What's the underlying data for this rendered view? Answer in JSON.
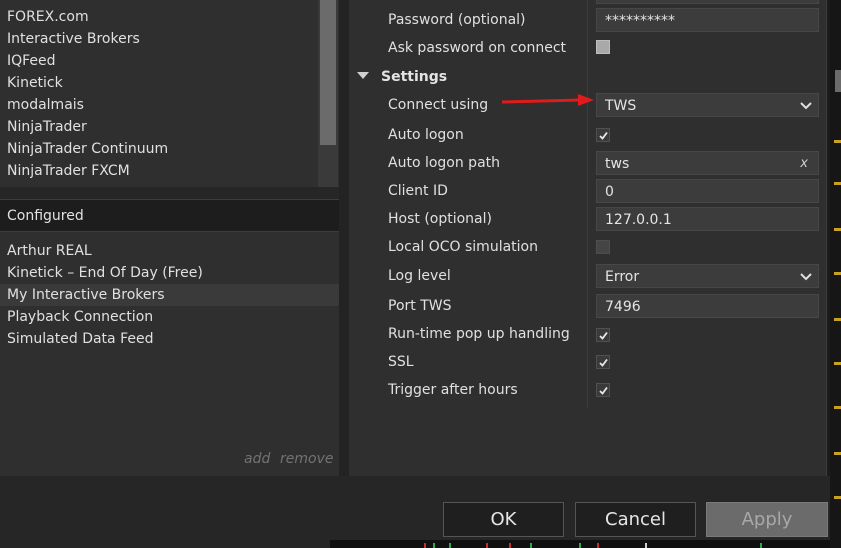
{
  "providers": [
    "FOREX.com",
    "Interactive Brokers",
    "IQFeed",
    "Kinetick",
    "modalmais",
    "NinjaTrader",
    "NinjaTrader Continuum",
    "NinjaTrader FXCM"
  ],
  "configured": {
    "header": "Configured",
    "items": [
      "Arthur REAL",
      "Kinetick – End Of Day (Free)",
      "My Interactive Brokers",
      "Playback Connection",
      "Simulated Data Feed"
    ],
    "selected_index": 2,
    "add_label": "add",
    "remove_label": "remove"
  },
  "properties": {
    "password_label": "Password (optional)",
    "password_value": "**********",
    "ask_password_label": "Ask password on connect",
    "ask_password_checked": false,
    "settings_section": "Settings",
    "connect_using_label": "Connect using",
    "connect_using_value": "TWS",
    "auto_logon_label": "Auto logon",
    "auto_logon_checked": true,
    "auto_logon_path_label": "Auto logon path",
    "auto_logon_path_value": "tws",
    "clear_glyph": "x",
    "client_id_label": "Client ID",
    "client_id_value": "0",
    "host_label": "Host (optional)",
    "host_value": "127.0.0.1",
    "local_oco_label": "Local OCO simulation",
    "local_oco_checked": false,
    "log_level_label": "Log level",
    "log_level_value": "Error",
    "port_label": "Port TWS",
    "port_value": "7496",
    "runtime_popup_label": "Run-time pop up handling",
    "runtime_popup_checked": true,
    "ssl_label": "SSL",
    "ssl_checked": true,
    "trigger_after_hours_label": "Trigger after hours",
    "trigger_after_hours_checked": true
  },
  "buttons": {
    "ok": "OK",
    "cancel": "Cancel",
    "apply": "Apply",
    "apply_enabled": false
  },
  "annotation": {
    "arrow_color": "#e01b1b",
    "icon": "red-arrow-icon"
  },
  "colors": {
    "panel_bg": "#2f2f2f",
    "input_bg": "#3c3c3c",
    "accent_tick": "#c8a21e"
  }
}
